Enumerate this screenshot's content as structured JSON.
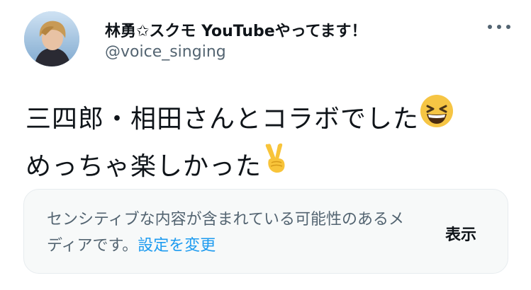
{
  "author": {
    "display_name": "林勇✩スクモ YouTubeやってます！",
    "handle": "@voice_singing"
  },
  "tweet": {
    "line1": "三四郎・相田さんとコラボでした",
    "line1_emoji": "grinning-squinting-face-emoji",
    "line2": "めっちゃ楽しかった",
    "line2_emoji": "victory-hand-emoji"
  },
  "sensitive_media": {
    "message": "センシティブな内容が含まれている可能性のあるメディアです。",
    "settings_link": "設定を変更",
    "show_button": "表示"
  },
  "colors": {
    "text": "#0f1419",
    "secondary": "#536471",
    "link": "#1d9bf0",
    "warning_bg": "#f7f9f9"
  }
}
